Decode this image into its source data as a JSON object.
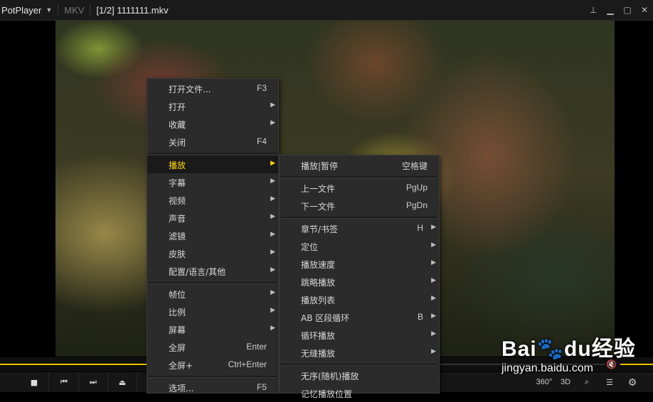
{
  "titlebar": {
    "app_name": "PotPlayer",
    "format": "MKV",
    "file_title": "[1/2] 1111111.mkv"
  },
  "icons": {
    "dropdown": "▼",
    "pin": "⊥",
    "minimize": "▁",
    "maximize": "▢",
    "close": "✕",
    "stop": "■",
    "prev": "⏮",
    "next": "⏭",
    "eject": "⏏",
    "playlist": "☰",
    "settings": "⚙",
    "search": "⌕",
    "speaker_muted": "🔇"
  },
  "playback": {
    "progress": 0.67,
    "volume_indicator_on": true
  },
  "controls": {
    "btn_360": "360°",
    "btn_3d": "3D"
  },
  "watermark": {
    "logo": "Bai🐾du经验",
    "url": "jingyan.baidu.com"
  },
  "main_menu": [
    {
      "label": "打开文件...",
      "key": "F3",
      "submenu": false
    },
    {
      "label": "打开",
      "key": "",
      "submenu": true
    },
    {
      "label": "收藏",
      "key": "",
      "submenu": true
    },
    {
      "label": "关闭",
      "key": "F4",
      "submenu": false
    },
    {
      "divider": true
    },
    {
      "label": "播放",
      "key": "",
      "submenu": true,
      "highlighted": true
    },
    {
      "label": "字幕",
      "key": "",
      "submenu": true
    },
    {
      "label": "视频",
      "key": "",
      "submenu": true
    },
    {
      "label": "声音",
      "key": "",
      "submenu": true
    },
    {
      "label": "滤镜",
      "key": "",
      "submenu": true
    },
    {
      "label": "皮肤",
      "key": "",
      "submenu": true
    },
    {
      "label": "配置/语言/其他",
      "key": "",
      "submenu": true
    },
    {
      "divider": true
    },
    {
      "label": "帧位",
      "key": "",
      "submenu": true
    },
    {
      "label": "比例",
      "key": "",
      "submenu": true
    },
    {
      "label": "屏幕",
      "key": "",
      "submenu": true
    },
    {
      "label": "全屏",
      "key": "Enter",
      "submenu": false
    },
    {
      "label": "全屏+",
      "key": "Ctrl+Enter",
      "submenu": false
    },
    {
      "divider": true
    },
    {
      "label": "选项...",
      "key": "F5",
      "submenu": false
    }
  ],
  "sub_menu": [
    {
      "label": "播放|暂停",
      "key": "空格键",
      "submenu": false
    },
    {
      "divider": true
    },
    {
      "label": "上一文件",
      "key": "PgUp",
      "submenu": false
    },
    {
      "label": "下一文件",
      "key": "PgDn",
      "submenu": false
    },
    {
      "divider": true
    },
    {
      "label": "章节/书签",
      "key": "H",
      "submenu": true
    },
    {
      "label": "定位",
      "key": "",
      "submenu": true
    },
    {
      "label": "播放速度",
      "key": "",
      "submenu": true
    },
    {
      "label": "跳略播放",
      "key": "",
      "submenu": true
    },
    {
      "label": "播放列表",
      "key": "",
      "submenu": true
    },
    {
      "label": "AB 区段循环",
      "key": "B",
      "submenu": true
    },
    {
      "label": "循环播放",
      "key": "",
      "submenu": true
    },
    {
      "label": "无缝播放",
      "key": "",
      "submenu": true
    },
    {
      "divider": true
    },
    {
      "label": "无序(随机)播放",
      "key": "",
      "submenu": false
    },
    {
      "label": "记忆播放位置",
      "key": "",
      "submenu": false
    }
  ]
}
